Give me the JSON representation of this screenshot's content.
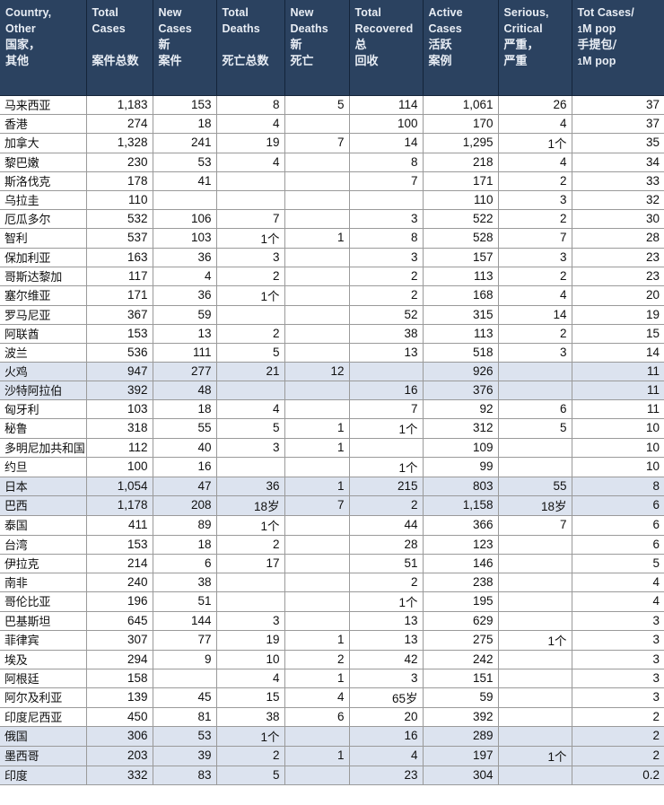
{
  "table": {
    "columns": [
      {
        "id": "country",
        "lines": [
          "Country,",
          "Other",
          "国家，",
          "其他"
        ],
        "kinds": [
          "en",
          "en",
          "cn",
          "cn"
        ]
      },
      {
        "id": "total_cases",
        "lines": [
          "Total",
          "Cases",
          "",
          "案件总数"
        ],
        "kinds": [
          "en",
          "en",
          "blank",
          "cn"
        ]
      },
      {
        "id": "new_cases",
        "lines": [
          "New",
          "Cases",
          "新",
          "案件"
        ],
        "kinds": [
          "en",
          "en",
          "cn",
          "cn"
        ]
      },
      {
        "id": "total_deaths",
        "lines": [
          "Total",
          "Deaths",
          "",
          "死亡总数"
        ],
        "kinds": [
          "en",
          "en",
          "blank",
          "cn"
        ]
      },
      {
        "id": "new_deaths",
        "lines": [
          "New",
          "Deaths",
          "新",
          "死亡"
        ],
        "kinds": [
          "en",
          "en",
          "cn",
          "cn"
        ]
      },
      {
        "id": "total_recovered",
        "lines": [
          "Total",
          "Recovered",
          "总",
          "回收"
        ],
        "kinds": [
          "en",
          "en",
          "cn",
          "cn"
        ]
      },
      {
        "id": "active_cases",
        "lines": [
          "Active",
          "Cases",
          "活跃",
          "案例"
        ],
        "kinds": [
          "en",
          "en",
          "cn",
          "cn"
        ]
      },
      {
        "id": "serious_critical",
        "lines": [
          "Serious,",
          "Critical",
          "严重，",
          "严重"
        ],
        "kinds": [
          "en",
          "en",
          "cn",
          "cn"
        ]
      },
      {
        "id": "tot_cases_per_1m",
        "lines": [
          "Tot Cases/",
          "1M pop",
          "手提包/",
          "1M pop"
        ],
        "kinds": [
          "en",
          "small",
          "cn-slash",
          "small"
        ]
      }
    ],
    "rows": [
      {
        "country": "马来西亚",
        "total_cases": "1,183",
        "new_cases": "153",
        "total_deaths": "8",
        "new_deaths": "5",
        "total_recovered": "114",
        "active_cases": "1,061",
        "serious_critical": "26",
        "tot_cases_per_1m": "37",
        "highlight": false
      },
      {
        "country": "香港",
        "total_cases": "274",
        "new_cases": "18",
        "total_deaths": "4",
        "new_deaths": "",
        "total_recovered": "100",
        "active_cases": "170",
        "serious_critical": "4",
        "tot_cases_per_1m": "37",
        "highlight": false
      },
      {
        "country": "加拿大",
        "total_cases": "1,328",
        "new_cases": "241",
        "total_deaths": "19",
        "new_deaths": "7",
        "total_recovered": "14",
        "active_cases": "1,295",
        "serious_critical": "1个",
        "tot_cases_per_1m": "35",
        "highlight": false
      },
      {
        "country": "黎巴嫩",
        "total_cases": "230",
        "new_cases": "53",
        "total_deaths": "4",
        "new_deaths": "",
        "total_recovered": "8",
        "active_cases": "218",
        "serious_critical": "4",
        "tot_cases_per_1m": "34",
        "highlight": false
      },
      {
        "country": "斯洛伐克",
        "total_cases": "178",
        "new_cases": "41",
        "total_deaths": "",
        "new_deaths": "",
        "total_recovered": "7",
        "active_cases": "171",
        "serious_critical": "2",
        "tot_cases_per_1m": "33",
        "highlight": false
      },
      {
        "country": "乌拉圭",
        "total_cases": "110",
        "new_cases": "",
        "total_deaths": "",
        "new_deaths": "",
        "total_recovered": "",
        "active_cases": "110",
        "serious_critical": "3",
        "tot_cases_per_1m": "32",
        "highlight": false
      },
      {
        "country": "厄瓜多尔",
        "total_cases": "532",
        "new_cases": "106",
        "total_deaths": "7",
        "new_deaths": "",
        "total_recovered": "3",
        "active_cases": "522",
        "serious_critical": "2",
        "tot_cases_per_1m": "30",
        "highlight": false
      },
      {
        "country": "智利",
        "total_cases": "537",
        "new_cases": "103",
        "total_deaths": "1个",
        "new_deaths": "1",
        "total_recovered": "8",
        "active_cases": "528",
        "serious_critical": "7",
        "tot_cases_per_1m": "28",
        "highlight": false
      },
      {
        "country": "保加利亚",
        "total_cases": "163",
        "new_cases": "36",
        "total_deaths": "3",
        "new_deaths": "",
        "total_recovered": "3",
        "active_cases": "157",
        "serious_critical": "3",
        "tot_cases_per_1m": "23",
        "highlight": false
      },
      {
        "country": "哥斯达黎加",
        "total_cases": "117",
        "new_cases": "4",
        "total_deaths": "2",
        "new_deaths": "",
        "total_recovered": "2",
        "active_cases": "113",
        "serious_critical": "2",
        "tot_cases_per_1m": "23",
        "highlight": false
      },
      {
        "country": "塞尔维亚",
        "total_cases": "171",
        "new_cases": "36",
        "total_deaths": "1个",
        "new_deaths": "",
        "total_recovered": "2",
        "active_cases": "168",
        "serious_critical": "4",
        "tot_cases_per_1m": "20",
        "highlight": false
      },
      {
        "country": "罗马尼亚",
        "total_cases": "367",
        "new_cases": "59",
        "total_deaths": "",
        "new_deaths": "",
        "total_recovered": "52",
        "active_cases": "315",
        "serious_critical": "14",
        "tot_cases_per_1m": "19",
        "highlight": false
      },
      {
        "country": "阿联酋",
        "total_cases": "153",
        "new_cases": "13",
        "total_deaths": "2",
        "new_deaths": "",
        "total_recovered": "38",
        "active_cases": "113",
        "serious_critical": "2",
        "tot_cases_per_1m": "15",
        "highlight": false
      },
      {
        "country": "波兰",
        "total_cases": "536",
        "new_cases": "111",
        "total_deaths": "5",
        "new_deaths": "",
        "total_recovered": "13",
        "active_cases": "518",
        "serious_critical": "3",
        "tot_cases_per_1m": "14",
        "highlight": false
      },
      {
        "country": "火鸡",
        "total_cases": "947",
        "new_cases": "277",
        "total_deaths": "21",
        "new_deaths": "12",
        "total_recovered": "",
        "active_cases": "926",
        "serious_critical": "",
        "tot_cases_per_1m": "11",
        "highlight": true
      },
      {
        "country": "沙特阿拉伯",
        "total_cases": "392",
        "new_cases": "48",
        "total_deaths": "",
        "new_deaths": "",
        "total_recovered": "16",
        "active_cases": "376",
        "serious_critical": "",
        "tot_cases_per_1m": "11",
        "highlight": true
      },
      {
        "country": "匈牙利",
        "total_cases": "103",
        "new_cases": "18",
        "total_deaths": "4",
        "new_deaths": "",
        "total_recovered": "7",
        "active_cases": "92",
        "serious_critical": "6",
        "tot_cases_per_1m": "11",
        "highlight": false
      },
      {
        "country": "秘鲁",
        "total_cases": "318",
        "new_cases": "55",
        "total_deaths": "5",
        "new_deaths": "1",
        "total_recovered": "1个",
        "active_cases": "312",
        "serious_critical": "5",
        "tot_cases_per_1m": "10",
        "highlight": false
      },
      {
        "country": "多明尼加共和国",
        "total_cases": "112",
        "new_cases": "40",
        "total_deaths": "3",
        "new_deaths": "1",
        "total_recovered": "",
        "active_cases": "109",
        "serious_critical": "",
        "tot_cases_per_1m": "10",
        "highlight": false
      },
      {
        "country": "约旦",
        "total_cases": "100",
        "new_cases": "16",
        "total_deaths": "",
        "new_deaths": "",
        "total_recovered": "1个",
        "active_cases": "99",
        "serious_critical": "",
        "tot_cases_per_1m": "10",
        "highlight": false
      },
      {
        "country": "日本",
        "total_cases": "1,054",
        "new_cases": "47",
        "total_deaths": "36",
        "new_deaths": "1",
        "total_recovered": "215",
        "active_cases": "803",
        "serious_critical": "55",
        "tot_cases_per_1m": "8",
        "highlight": true
      },
      {
        "country": "巴西",
        "total_cases": "1,178",
        "new_cases": "208",
        "total_deaths": "18岁",
        "new_deaths": "7",
        "total_recovered": "2",
        "active_cases": "1,158",
        "serious_critical": "18岁",
        "tot_cases_per_1m": "6",
        "highlight": true
      },
      {
        "country": "泰国",
        "total_cases": "411",
        "new_cases": "89",
        "total_deaths": "1个",
        "new_deaths": "",
        "total_recovered": "44",
        "active_cases": "366",
        "serious_critical": "7",
        "tot_cases_per_1m": "6",
        "highlight": false
      },
      {
        "country": "台湾",
        "total_cases": "153",
        "new_cases": "18",
        "total_deaths": "2",
        "new_deaths": "",
        "total_recovered": "28",
        "active_cases": "123",
        "serious_critical": "",
        "tot_cases_per_1m": "6",
        "highlight": false
      },
      {
        "country": "伊拉克",
        "total_cases": "214",
        "new_cases": "6",
        "total_deaths": "17",
        "new_deaths": "",
        "total_recovered": "51",
        "active_cases": "146",
        "serious_critical": "",
        "tot_cases_per_1m": "5",
        "highlight": false
      },
      {
        "country": "南非",
        "total_cases": "240",
        "new_cases": "38",
        "total_deaths": "",
        "new_deaths": "",
        "total_recovered": "2",
        "active_cases": "238",
        "serious_critical": "",
        "tot_cases_per_1m": "4",
        "highlight": false
      },
      {
        "country": "哥伦比亚",
        "total_cases": "196",
        "new_cases": "51",
        "total_deaths": "",
        "new_deaths": "",
        "total_recovered": "1个",
        "active_cases": "195",
        "serious_critical": "",
        "tot_cases_per_1m": "4",
        "highlight": false
      },
      {
        "country": "巴基斯坦",
        "total_cases": "645",
        "new_cases": "144",
        "total_deaths": "3",
        "new_deaths": "",
        "total_recovered": "13",
        "active_cases": "629",
        "serious_critical": "",
        "tot_cases_per_1m": "3",
        "highlight": false
      },
      {
        "country": "菲律宾",
        "total_cases": "307",
        "new_cases": "77",
        "total_deaths": "19",
        "new_deaths": "1",
        "total_recovered": "13",
        "active_cases": "275",
        "serious_critical": "1个",
        "tot_cases_per_1m": "3",
        "highlight": false
      },
      {
        "country": "埃及",
        "total_cases": "294",
        "new_cases": "9",
        "total_deaths": "10",
        "new_deaths": "2",
        "total_recovered": "42",
        "active_cases": "242",
        "serious_critical": "",
        "tot_cases_per_1m": "3",
        "highlight": false
      },
      {
        "country": "阿根廷",
        "total_cases": "158",
        "new_cases": "",
        "total_deaths": "4",
        "new_deaths": "1",
        "total_recovered": "3",
        "active_cases": "151",
        "serious_critical": "",
        "tot_cases_per_1m": "3",
        "highlight": false
      },
      {
        "country": "阿尔及利亚",
        "total_cases": "139",
        "new_cases": "45",
        "total_deaths": "15",
        "new_deaths": "4",
        "total_recovered": "65岁",
        "active_cases": "59",
        "serious_critical": "",
        "tot_cases_per_1m": "3",
        "highlight": false
      },
      {
        "country": "印度尼西亚",
        "total_cases": "450",
        "new_cases": "81",
        "total_deaths": "38",
        "new_deaths": "6",
        "total_recovered": "20",
        "active_cases": "392",
        "serious_critical": "",
        "tot_cases_per_1m": "2",
        "highlight": false
      },
      {
        "country": "俄国",
        "total_cases": "306",
        "new_cases": "53",
        "total_deaths": "1个",
        "new_deaths": "",
        "total_recovered": "16",
        "active_cases": "289",
        "serious_critical": "",
        "tot_cases_per_1m": "2",
        "highlight": true
      },
      {
        "country": "墨西哥",
        "total_cases": "203",
        "new_cases": "39",
        "total_deaths": "2",
        "new_deaths": "1",
        "total_recovered": "4",
        "active_cases": "197",
        "serious_critical": "1个",
        "tot_cases_per_1m": "2",
        "highlight": true
      },
      {
        "country": "印度",
        "total_cases": "332",
        "new_cases": "83",
        "total_deaths": "5",
        "new_deaths": "",
        "total_recovered": "23",
        "active_cases": "304",
        "serious_critical": "",
        "tot_cases_per_1m": "0.2",
        "highlight": true
      }
    ]
  },
  "colors": {
    "header_background": "#2B4260",
    "header_text": "#E8EDF4",
    "highlight_row": "#DCE3EF",
    "grid_line": "#9A9A9A"
  }
}
